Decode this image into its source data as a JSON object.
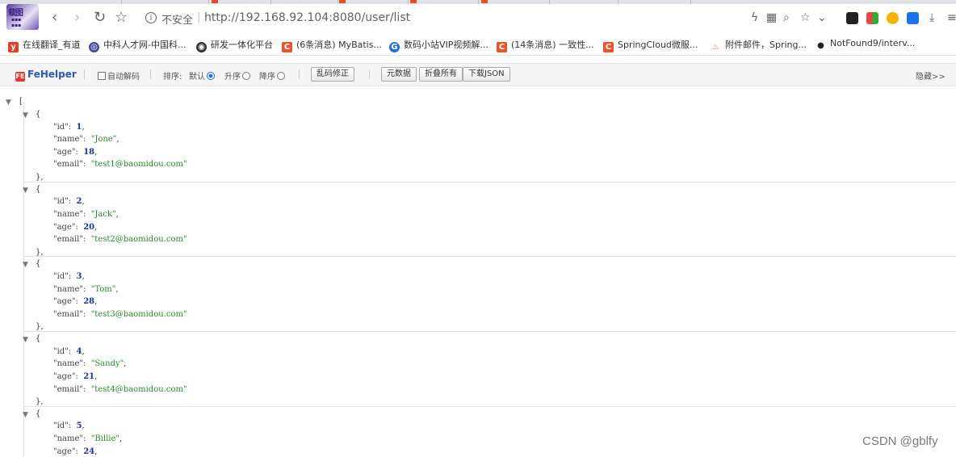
{
  "browser": {
    "avatar_text": "载图",
    "url_security": "不安全",
    "url_separator": "|",
    "url": "http://192.168.92.104:8080/user/list",
    "back_glyph": "‹",
    "forward_glyph": "›",
    "reload_glyph": "↻",
    "star_glyph": "☆"
  },
  "bookmarks": [
    {
      "label": "在线翻译_有道",
      "icon": "youdao-icon",
      "glyph": "y",
      "color": "#e33c2b"
    },
    {
      "label": "中科人才网-中国科...",
      "icon": "zhongke-icon",
      "glyph": "◎",
      "color": "#4a4aa0"
    },
    {
      "label": "研发一体化平台",
      "icon": "devops-icon",
      "glyph": "◉",
      "color": "#333333"
    },
    {
      "label": "(6条消息) MyBatis...",
      "icon": "csdn-icon",
      "glyph": "C",
      "color": "#e8552d"
    },
    {
      "label": "数码小站VIP视频解...",
      "icon": "video-icon",
      "glyph": "G",
      "color": "#2a6fd6"
    },
    {
      "label": "(14条消息) 一致性...",
      "icon": "csdn-icon",
      "glyph": "C",
      "color": "#e8552d"
    },
    {
      "label": "SpringCloud微服...",
      "icon": "csdn-icon",
      "glyph": "C",
      "color": "#e8552d"
    },
    {
      "label": "附件邮件，Spring...",
      "icon": "fire-icon",
      "glyph": "♨",
      "color": "#e8552d"
    },
    {
      "label": "NotFound9/interv...",
      "icon": "github-icon",
      "glyph": "●",
      "color": "#222222"
    }
  ],
  "fehelper": {
    "logo": "FeHelper",
    "logo_badge": "FE",
    "auto_decode": "自动解码",
    "sort_label": "排序:",
    "sort_default": "默认",
    "sort_asc": "升序",
    "sort_desc": "降序",
    "fix_garble": "乱码修正",
    "raw_data": "元数据",
    "collapse_all": "折叠所有",
    "download_json": "下载JSON",
    "hide": "隐藏>>"
  },
  "json_view": {
    "open_bracket": "[",
    "open_brace": "{",
    "close_brace": "},",
    "users": [
      {
        "id": "1",
        "name": "\"Jone\"",
        "age": "18",
        "email": "\"test1@baomidou.com\""
      },
      {
        "id": "2",
        "name": "\"Jack\"",
        "age": "20",
        "email": "\"test2@baomidou.com\""
      },
      {
        "id": "3",
        "name": "\"Tom\"",
        "age": "28",
        "email": "\"test3@baomidou.com\""
      },
      {
        "id": "4",
        "name": "\"Sandy\"",
        "age": "21",
        "email": "\"test4@baomidou.com\""
      },
      {
        "id": "5",
        "name": "\"Billie\"",
        "age": "24"
      }
    ],
    "keys": {
      "id": "\"id\":",
      "name": "\"name\":",
      "age": "\"age\":",
      "email": "\"email\":"
    }
  },
  "watermark": "CSDN @gblfy"
}
